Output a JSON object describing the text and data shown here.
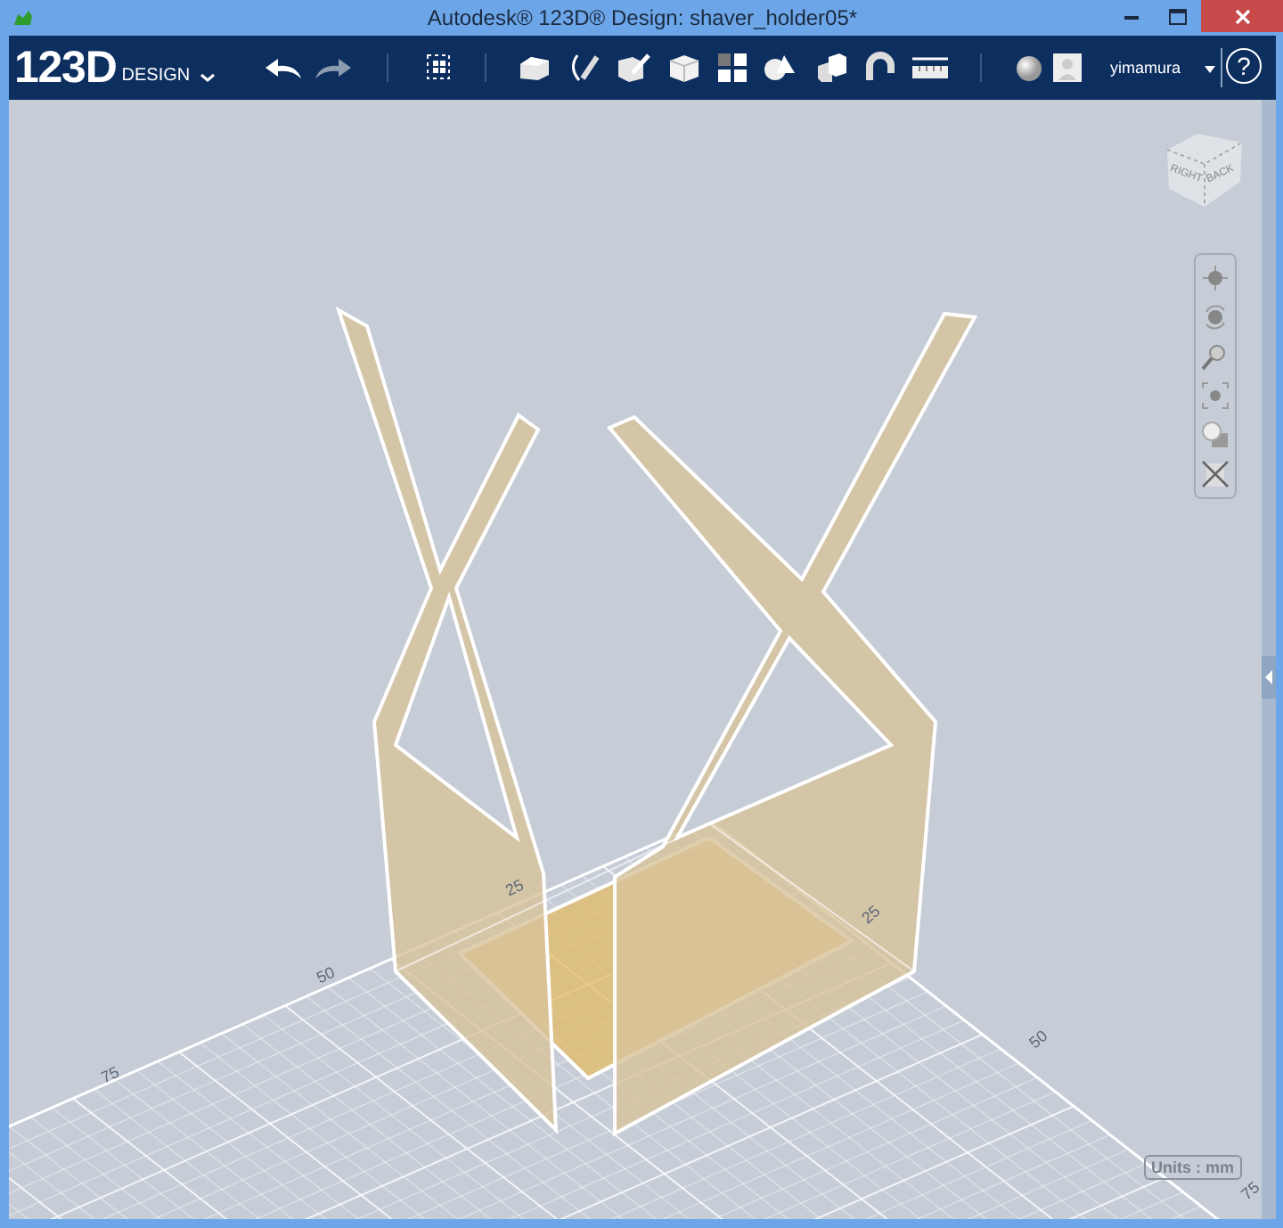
{
  "window": {
    "title": "Autodesk® 123D® Design: shaver_holder05*"
  },
  "app_menu": {
    "logo": "123D",
    "label": "DESIGN"
  },
  "toolbar": {
    "user": "yimamura",
    "help": "?"
  },
  "view_cube": {
    "faces": [
      "RIGHT",
      "BACK"
    ]
  },
  "grid_labels": [
    "25",
    "50",
    "75",
    "25",
    "50",
    "75"
  ],
  "units": "Units : mm"
}
